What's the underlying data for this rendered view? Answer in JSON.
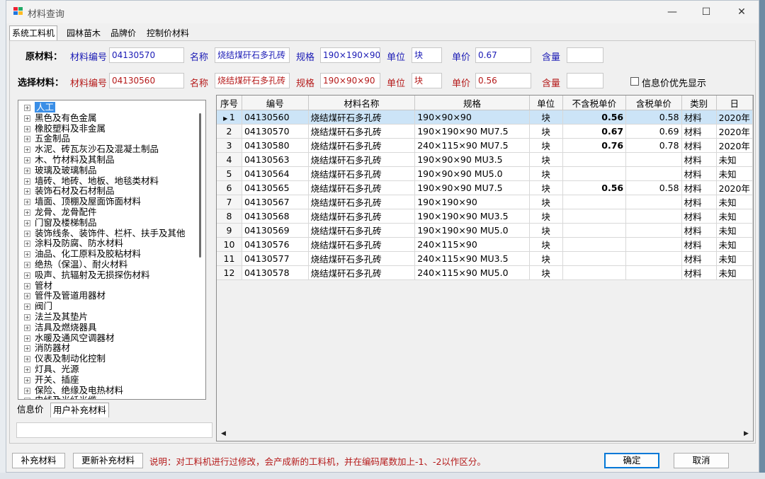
{
  "window": {
    "title": "材料查询",
    "minimize": "—",
    "maximize": "☐",
    "close": "✕"
  },
  "tabs": [
    "系统工料机",
    "园林苗木",
    "品牌价",
    "控制价材料"
  ],
  "original": {
    "label": "原材料：",
    "code_label": "材料编号",
    "code": "04130570",
    "name_label": "名称",
    "name": "烧结煤矸石多孔砖",
    "spec_label": "规格",
    "spec": "190×190×90",
    "unit_label": "单位",
    "unit": "块",
    "price_label": "单价",
    "price": "0.67",
    "qty_label": "含量",
    "qty": ""
  },
  "selected": {
    "label": "选择材料：",
    "code_label": "材料编号",
    "code": "04130560",
    "name_label": "名称",
    "name": "烧结煤矸石多孔砖",
    "spec_label": "规格",
    "spec": "190×90×90",
    "unit_label": "单位",
    "unit": "块",
    "price_label": "单价",
    "price": "0.56",
    "qty_label": "含量",
    "qty": ""
  },
  "priority_checkbox": {
    "label": "信息价优先显示",
    "checked": false
  },
  "tree": {
    "items": [
      "人工",
      "黑色及有色金属",
      "橡胶塑料及非金属",
      "五金制品",
      "水泥、砖瓦灰沙石及混凝土制品",
      "木、竹材料及其制品",
      "玻璃及玻璃制品",
      "墙砖、地砖、地板、地毯类材料",
      "装饰石材及石材制品",
      "墙面、顶棚及屋面饰面材料",
      "龙骨、龙骨配件",
      "门窗及楼梯制品",
      "装饰线条、装饰件、栏杆、扶手及其他",
      "涂料及防腐、防水材料",
      "油品、化工原料及胶粘材料",
      "绝热（保温）、耐火材料",
      "吸声、抗辐射及无损探伤材料",
      "管材",
      "管件及管道用器材",
      "阀门",
      "法兰及其垫片",
      "洁具及燃烧器具",
      "水暖及通风空调器材",
      "消防器材",
      "仪表及制动化控制",
      "灯具、光源",
      "开关、插座",
      "保险、绝缘及电热材料",
      "电线及光纤光缆"
    ],
    "selected_index": 0
  },
  "sub_tabs": [
    "信息价",
    "用户补充材料"
  ],
  "table": {
    "headers": [
      "序号",
      "编号",
      "材料名称",
      "规格",
      "单位",
      "不含税单价",
      "含税单价",
      "类别",
      "日"
    ],
    "rows": [
      [
        "1",
        "04130560",
        "烧结煤矸石多孔砖",
        "190×90×90",
        "块",
        "0.56",
        "0.58",
        "材料",
        "2020年"
      ],
      [
        "2",
        "04130570",
        "烧结煤矸石多孔砖",
        "190×190×90 MU7.5",
        "块",
        "0.67",
        "0.69",
        "材料",
        "2020年"
      ],
      [
        "3",
        "04130580",
        "烧结煤矸石多孔砖",
        "240×115×90 MU7.5",
        "块",
        "0.76",
        "0.78",
        "材料",
        "2020年"
      ],
      [
        "4",
        "04130563",
        "烧结煤矸石多孔砖",
        "190×90×90 MU3.5",
        "块",
        "",
        "",
        "材料",
        "未知"
      ],
      [
        "5",
        "04130564",
        "烧结煤矸石多孔砖",
        "190×90×90 MU5.0",
        "块",
        "",
        "",
        "材料",
        "未知"
      ],
      [
        "6",
        "04130565",
        "烧结煤矸石多孔砖",
        "190×90×90  MU7.5",
        "块",
        "0.56",
        "0.58",
        "材料",
        "2020年"
      ],
      [
        "7",
        "04130567",
        "烧结煤矸石多孔砖",
        "190×190×90",
        "块",
        "",
        "",
        "材料",
        "未知"
      ],
      [
        "8",
        "04130568",
        "烧结煤矸石多孔砖",
        "190×190×90 MU3.5",
        "块",
        "",
        "",
        "材料",
        "未知"
      ],
      [
        "9",
        "04130569",
        "烧结煤矸石多孔砖",
        "190×190×90 MU5.0",
        "块",
        "",
        "",
        "材料",
        "未知"
      ],
      [
        "10",
        "04130576",
        "烧结煤矸石多孔砖",
        "240×115×90",
        "块",
        "",
        "",
        "材料",
        "未知"
      ],
      [
        "11",
        "04130577",
        "烧结煤矸石多孔砖",
        "240×115×90 MU3.5",
        "块",
        "",
        "",
        "材料",
        "未知"
      ],
      [
        "12",
        "04130578",
        "烧结煤矸石多孔砖",
        "240×115×90 MU5.0",
        "块",
        "",
        "",
        "材料",
        "未知"
      ]
    ],
    "selected_row": 0
  },
  "buttons": {
    "supplement": "补充材料",
    "update_supplement": "更新补充材料",
    "ok": "确定",
    "cancel": "取消"
  },
  "note": "说明：对工料机进行过修改，会产成新的工料机，并在编码尾数加上-1、-2以作区分。",
  "colors": {
    "label_blue": "#1a1ab5",
    "label_red": "#b51a1a",
    "selection": "#cce4f7",
    "tree_selection": "#3a8ee6"
  }
}
